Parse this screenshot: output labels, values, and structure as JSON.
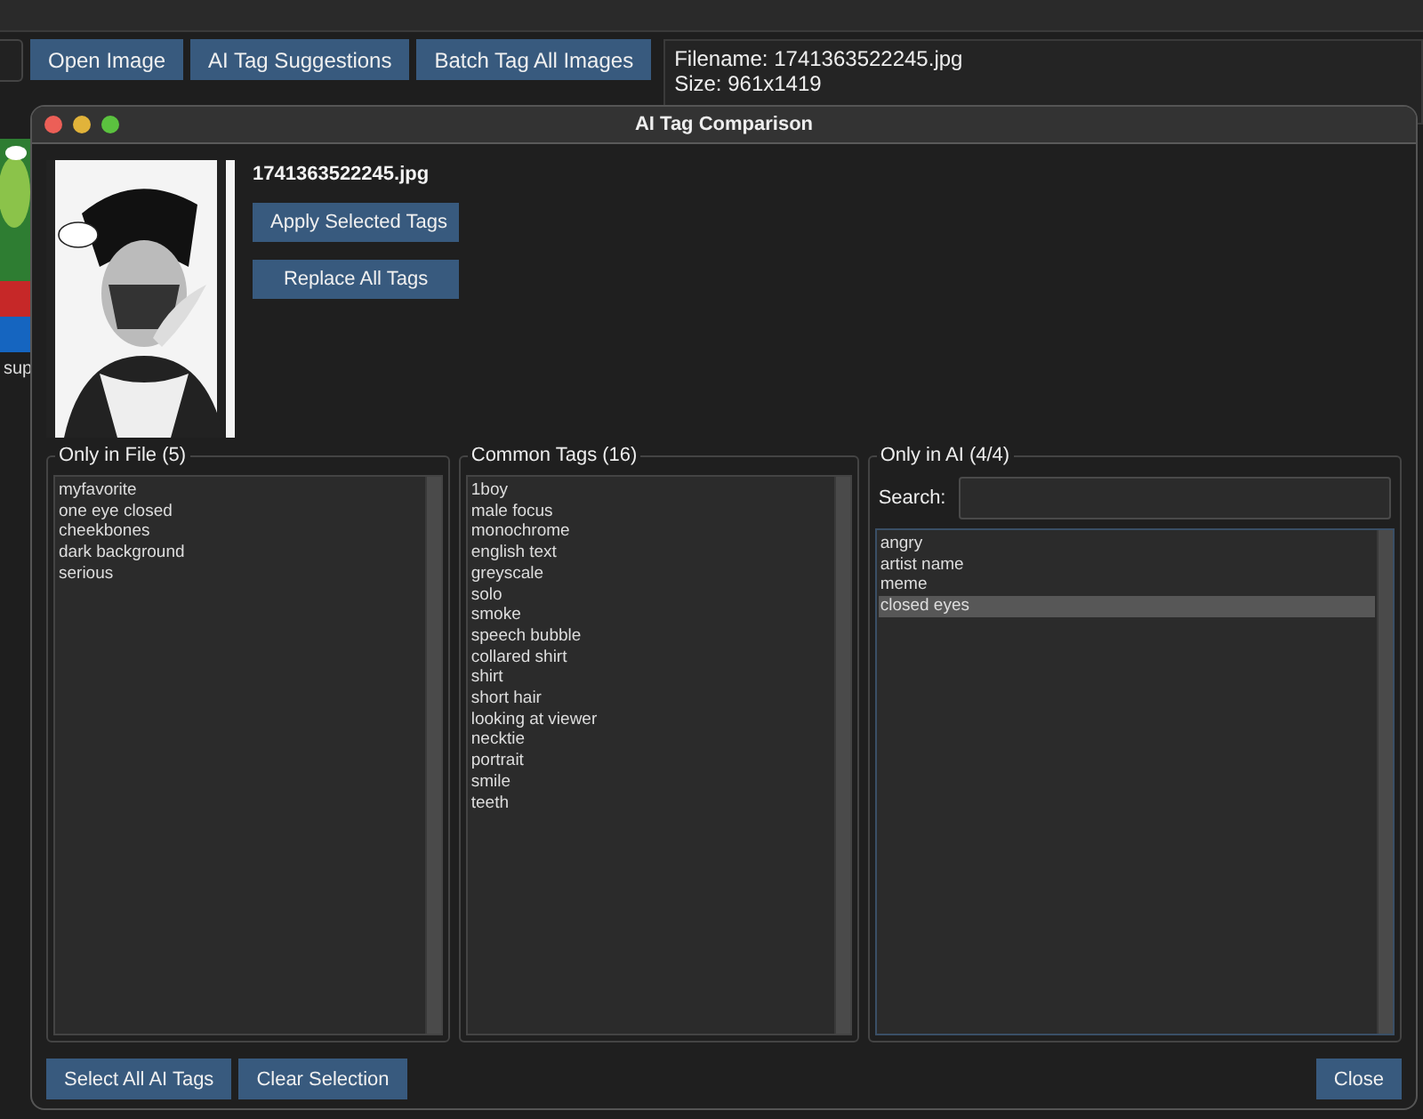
{
  "toolbar": {
    "buttons": [
      "Open Image",
      "AI Tag Suggestions",
      "Batch Tag All Images"
    ]
  },
  "info_panel": {
    "lines": [
      "Filename: 1741363522245.jpg",
      "Size: 961x1419"
    ]
  },
  "thumbnail_caption": "sup",
  "dialog": {
    "title": "AI Tag Comparison",
    "filename": "1741363522245.jpg",
    "actions": [
      "Apply Selected Tags",
      "Replace All Tags"
    ],
    "groups": [
      {
        "kind": "list",
        "title": "Only in File (5)",
        "items": [
          {
            "label": "myfavorite",
            "selected": false
          },
          {
            "label": "one eye closed",
            "selected": false
          },
          {
            "label": "cheekbones",
            "selected": false
          },
          {
            "label": "dark background",
            "selected": false
          },
          {
            "label": "serious",
            "selected": false
          }
        ]
      },
      {
        "kind": "list",
        "title": "Common Tags (16)",
        "items": [
          {
            "label": "1boy",
            "selected": false
          },
          {
            "label": "male focus",
            "selected": false
          },
          {
            "label": "monochrome",
            "selected": false
          },
          {
            "label": "english text",
            "selected": false
          },
          {
            "label": "greyscale",
            "selected": false
          },
          {
            "label": "solo",
            "selected": false
          },
          {
            "label": "smoke",
            "selected": false
          },
          {
            "label": "speech bubble",
            "selected": false
          },
          {
            "label": "collared shirt",
            "selected": false
          },
          {
            "label": "shirt",
            "selected": false
          },
          {
            "label": "short hair",
            "selected": false
          },
          {
            "label": "looking at viewer",
            "selected": false
          },
          {
            "label": "necktie",
            "selected": false
          },
          {
            "label": "portrait",
            "selected": false
          },
          {
            "label": "smile",
            "selected": false
          },
          {
            "label": "teeth",
            "selected": false
          }
        ]
      },
      {
        "kind": "search_list",
        "title": "Only in AI (4/4)",
        "search_label": "Search:",
        "items": [
          {
            "label": "angry",
            "selected": false
          },
          {
            "label": "artist name",
            "selected": false
          },
          {
            "label": "meme",
            "selected": false
          },
          {
            "label": "closed eyes",
            "selected": true
          }
        ]
      }
    ],
    "footer_left": [
      "Select All AI Tags",
      "Clear Selection"
    ],
    "footer_right": "Close"
  }
}
